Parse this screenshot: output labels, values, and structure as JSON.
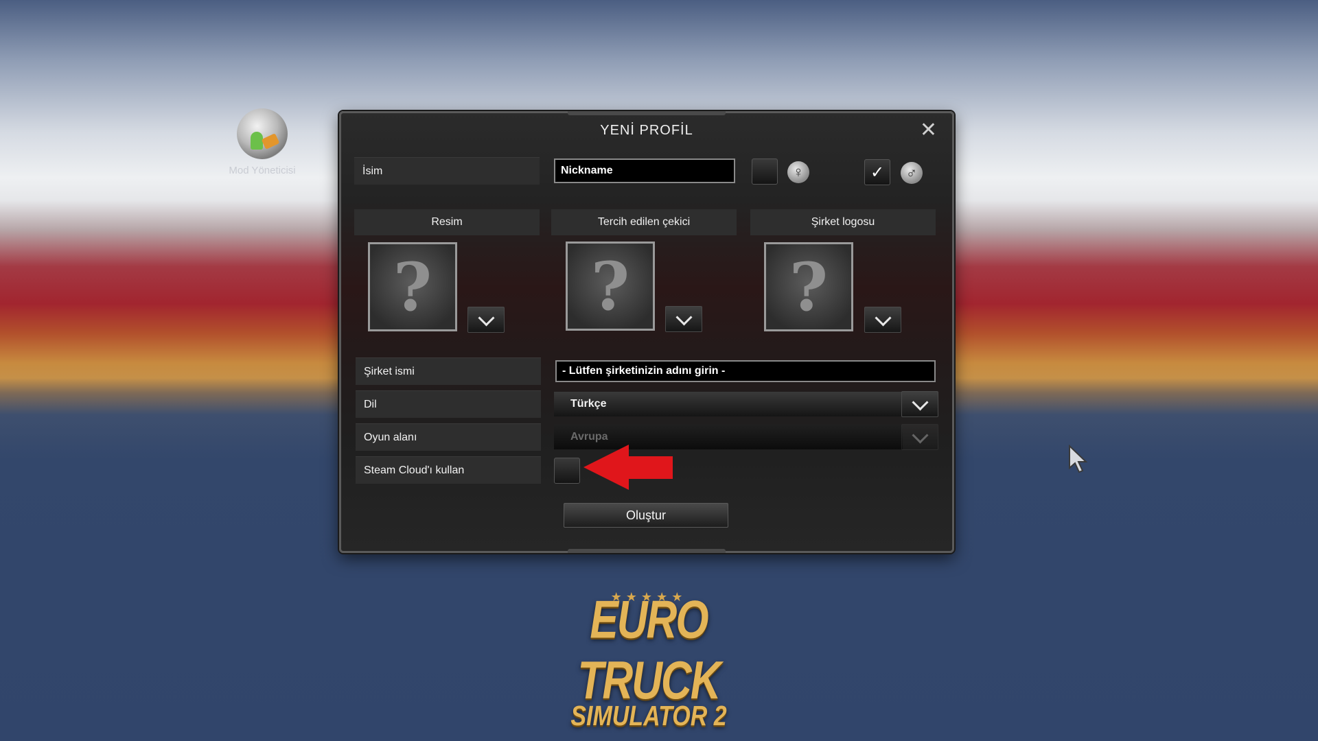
{
  "desktop": {
    "mod_manager_label": "Mod Yöneticisi"
  },
  "dialog": {
    "title": "YENİ PROFİL",
    "close_icon": "close-icon",
    "name_label": "İsim",
    "name_value": "Nickname",
    "gender": {
      "female_selected": false,
      "male_selected": true,
      "female_icon": "♀",
      "male_icon": "♂",
      "check": "✓"
    },
    "headers": {
      "picture": "Resim",
      "truck": "Tercih edilen çekici",
      "logo": "Şirket logosu"
    },
    "placeholder_glyph": "?",
    "company_label": "Şirket ismi",
    "company_value": "- Lütfen şirketinizin adını girin -",
    "language_label": "Dil",
    "language_value": "Türkçe",
    "map_label": "Oyun alanı",
    "map_value": "Avrupa",
    "steam_cloud_label": "Steam Cloud'ı kullan",
    "steam_cloud_checked": false,
    "create_button": "Oluştur"
  },
  "logo": {
    "line1": "EURO TRUCK",
    "line2": "SIMULATOR 2",
    "stars": "★★★★★"
  },
  "colors": {
    "annotation_arrow": "#e0161b",
    "logo_gold": "#e3b457"
  }
}
